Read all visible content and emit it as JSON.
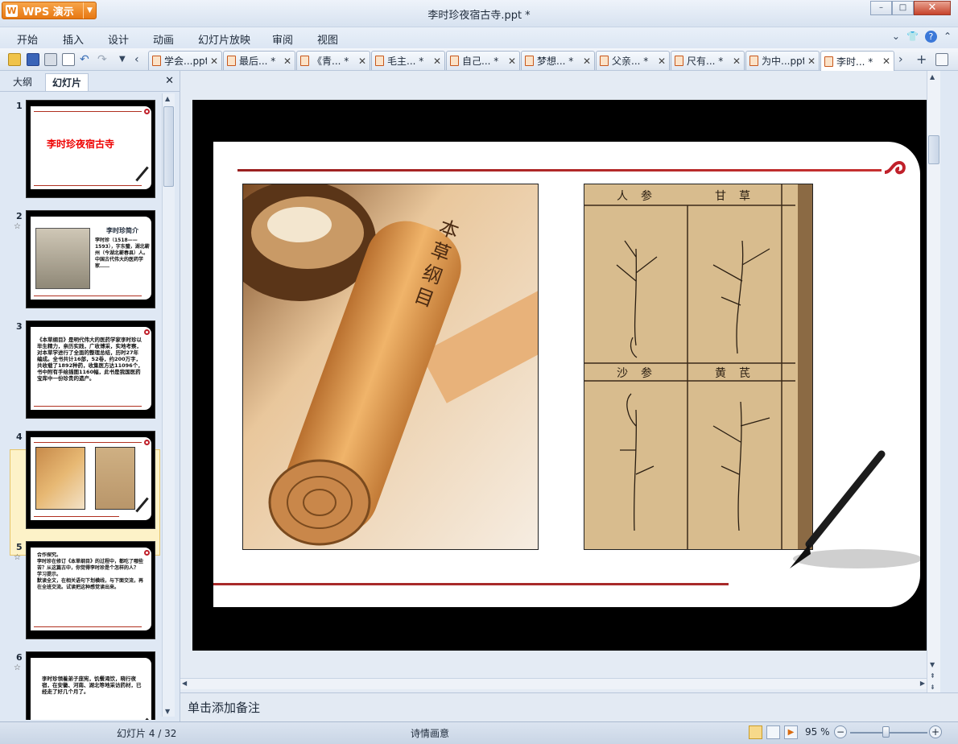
{
  "app": {
    "button_label": "WPS 演示",
    "logo_glyph": "W",
    "title": "李时珍夜宿古寺.ppt *"
  },
  "window_buttons": {
    "minimize": "–",
    "maximize": "□",
    "close": "✕"
  },
  "menu": [
    "开始",
    "插入",
    "设计",
    "动画",
    "幻灯片放映",
    "审阅",
    "视图"
  ],
  "tabs": [
    {
      "label": "学会...ppt",
      "active": false
    },
    {
      "label": "最后... *",
      "active": false
    },
    {
      "label": "《青... *",
      "active": false
    },
    {
      "label": "毛主... *",
      "active": false
    },
    {
      "label": "自己... *",
      "active": false
    },
    {
      "label": "梦想... *",
      "active": false
    },
    {
      "label": "父亲... *",
      "active": false
    },
    {
      "label": "尺有... *",
      "active": false
    },
    {
      "label": "为中...ppt",
      "active": false
    },
    {
      "label": "李时... *",
      "active": true
    }
  ],
  "left_panel": {
    "tab_outline": "大纲",
    "tab_slides": "幻灯片",
    "close": "✕"
  },
  "thumbnails": [
    {
      "num": "1",
      "star": "",
      "title": "李时珍夜宿古寺",
      "text": ""
    },
    {
      "num": "2",
      "star": "☆",
      "title": "李时珍简介",
      "text": "李时珍（1518——1593），字东璧，湖北蕲州（今湖北蕲春县）人。中国古代伟大的医药学家……"
    },
    {
      "num": "3",
      "star": "",
      "title": "",
      "text": "《本草纲目》是明代伟大的医药学家李时珍以毕生精力，亲历实践，广收博采，实地考察，对本草学进行了全面的整理总结，历时27年编成。全书共计16部，52卷，约200万字，共收载了1892种药，收集医方达11096个，书中附有手绘插图1160幅，此书是我国医药宝库中一份珍贵的遗产。"
    },
    {
      "num": "4",
      "star": "",
      "title": "",
      "text": ""
    },
    {
      "num": "5",
      "star": "☆",
      "title": "",
      "text": "合作探究。\n李时珍在修订《本草纲目》的过程中，都吃了哪些苦？从这篇古中，你觉得李时珍是个怎样的人？\n学习提示。\n默读全文，在相关语句下划横线，与下面交流，再在全班交流。试读把这种感觉读出来。"
    },
    {
      "num": "6",
      "star": "☆",
      "title": "",
      "text": "李时珍领着弟子庞宪，饥餐渴饮，晓行夜宿，在安徽、河南、湖北等地采访药材，已经走了好几个月了。"
    }
  ],
  "slide_images": {
    "img1_label": "本草纲目",
    "img2_labels": [
      "人参",
      "甘草",
      "沙参",
      "黄芪"
    ]
  },
  "notes_placeholder": "单击添加备注",
  "status": {
    "slide_counter": "幻灯片 4 / 32",
    "theme": "诗情画意",
    "zoom": "95 %"
  },
  "colors": {
    "accent_orange": "#e77812",
    "slide_red": "#a82a2a",
    "chrome_blue": "#dfe8f4"
  }
}
